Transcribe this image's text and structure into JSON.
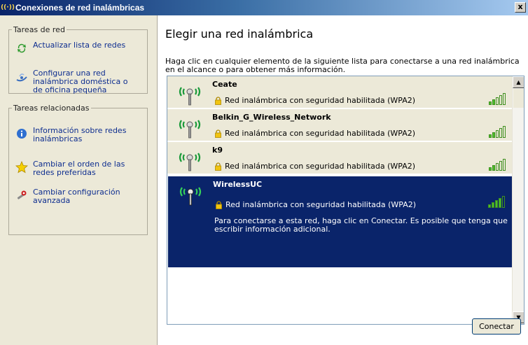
{
  "window": {
    "title": "Conexiones de red inalámbricas",
    "close_label": "x"
  },
  "sidebar": {
    "network_tasks": {
      "title": "Tareas de red",
      "items": [
        {
          "label": "Actualizar lista de redes",
          "icon": "refresh-icon"
        },
        {
          "label": "Configurar una red inalámbrica doméstica o de oficina pequeña",
          "icon": "wizard-icon"
        }
      ]
    },
    "related_tasks": {
      "title": "Tareas relacionadas",
      "items": [
        {
          "label": "Información sobre redes inalámbricas",
          "icon": "info-icon"
        },
        {
          "label": "Cambiar el orden de las redes preferidas",
          "icon": "star-icon"
        },
        {
          "label": "Cambiar configuración avanzada",
          "icon": "advanced-settings-icon"
        }
      ]
    }
  },
  "main": {
    "heading": "Elegir una red inalámbrica",
    "description": "Haga clic en cualquier elemento de la siguiente lista para conectarse a una red inalámbrica en el alcance o para obtener más información.",
    "networks": [
      {
        "name": "Ceate",
        "security": "Red inalámbrica con seguridad habilitada (WPA2)",
        "signal_bars": 2,
        "selected": false
      },
      {
        "name": "Belkin_G_Wireless_Network",
        "security": "Red inalámbrica con seguridad habilitada (WPA2)",
        "signal_bars": 2,
        "selected": false
      },
      {
        "name": "k9",
        "security": "Red inalámbrica con seguridad habilitada (WPA2)",
        "signal_bars": 2,
        "selected": false
      },
      {
        "name": "WirelessUC",
        "security": "Red inalámbrica con seguridad habilitada (WPA2)",
        "signal_bars": 4,
        "selected": true,
        "info": "Para conectarse a esta red, haga clic en Conectar. Es posible que tenga que escribir información adicional."
      }
    ],
    "connect_button": "Conectar"
  },
  "colors": {
    "titlebar": "#0a246a",
    "selection": "#0a246a",
    "task_link": "#0d2d8f",
    "panel": "#ece9d8"
  }
}
